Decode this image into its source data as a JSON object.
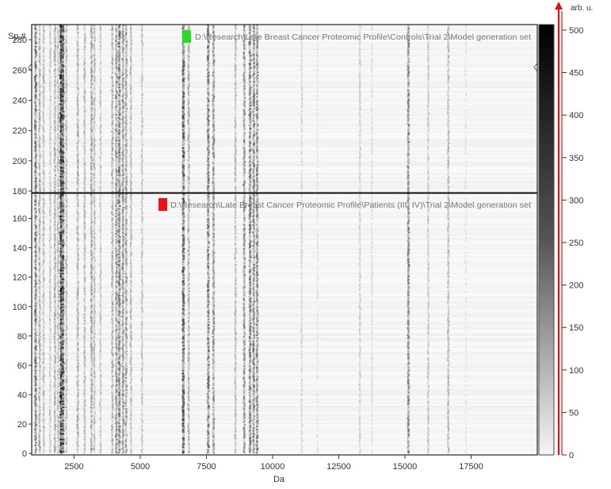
{
  "chart_data": {
    "type": "heatmap",
    "xlabel": "Da",
    "x_ticks": [
      "2500",
      "5000",
      "7500",
      "10000",
      "12500",
      "15000",
      "17500"
    ],
    "x_tick_values": [
      2500,
      5000,
      7500,
      10000,
      12500,
      15000,
      17500
    ],
    "xlim": [
      900,
      20000
    ],
    "colorbar": {
      "label": "arb. u.",
      "ticks": [
        "0",
        "50",
        "100",
        "150",
        "200",
        "250",
        "300",
        "350",
        "400",
        "450",
        "500"
      ],
      "tick_values": [
        0,
        50,
        100,
        150,
        200,
        250,
        300,
        350,
        400,
        450,
        500
      ],
      "range": [
        0,
        500
      ]
    },
    "panels": [
      {
        "title": "D:\\Research\\Late Breast Cancer Proteomic Profile\\Controls\\Trial 2\\Model generation set",
        "marker_color": "#22dd22",
        "ylabel": "Sp.#",
        "y_ticks": [
          "180",
          "200",
          "220",
          "240",
          "260",
          "280"
        ],
        "y_tick_values": [
          180,
          200,
          220,
          240,
          260,
          280
        ],
        "ylim": [
          179,
          290
        ],
        "spectra_range": [
          179,
          290
        ]
      },
      {
        "title": "D:\\Research\\Late Breast Cancer Proteomic Profile\\Patients (III, IV)\\Trial 2\\Model generation set",
        "marker_color": "#ee1111",
        "ylabel": "",
        "y_ticks": [
          "0",
          "20",
          "40",
          "60",
          "80",
          "100",
          "120",
          "140",
          "160"
        ],
        "y_tick_values": [
          0,
          20,
          40,
          60,
          80,
          100,
          120,
          140,
          160
        ],
        "ylim": [
          -1,
          177
        ],
        "spectra_range": [
          0,
          177
        ]
      }
    ],
    "peaks_da": [
      {
        "mass": 1050,
        "intensity": 0.55
      },
      {
        "mass": 1200,
        "intensity": 0.35
      },
      {
        "mass": 1350,
        "intensity": 0.3
      },
      {
        "mass": 1600,
        "intensity": 0.25
      },
      {
        "mass": 1780,
        "intensity": 0.35
      },
      {
        "mass": 1900,
        "intensity": 0.3
      },
      {
        "mass": 2020,
        "intensity": 0.9
      },
      {
        "mass": 2080,
        "intensity": 0.7
      },
      {
        "mass": 2210,
        "intensity": 0.3
      },
      {
        "mass": 2640,
        "intensity": 0.35
      },
      {
        "mass": 2900,
        "intensity": 0.3
      },
      {
        "mass": 3160,
        "intensity": 0.4
      },
      {
        "mass": 3270,
        "intensity": 0.3
      },
      {
        "mass": 3500,
        "intensity": 0.25
      },
      {
        "mass": 3950,
        "intensity": 0.35
      },
      {
        "mass": 4100,
        "intensity": 0.45
      },
      {
        "mass": 4210,
        "intensity": 0.55
      },
      {
        "mass": 4350,
        "intensity": 0.45
      },
      {
        "mass": 4470,
        "intensity": 0.4
      },
      {
        "mass": 4650,
        "intensity": 0.3
      },
      {
        "mass": 5070,
        "intensity": 0.25
      },
      {
        "mass": 6630,
        "intensity": 0.65
      },
      {
        "mass": 6830,
        "intensity": 0.35
      },
      {
        "mass": 7570,
        "intensity": 0.55
      },
      {
        "mass": 7770,
        "intensity": 0.45
      },
      {
        "mass": 8600,
        "intensity": 0.3
      },
      {
        "mass": 8930,
        "intensity": 0.45
      },
      {
        "mass": 9150,
        "intensity": 0.55
      },
      {
        "mass": 9290,
        "intensity": 0.5
      },
      {
        "mass": 9420,
        "intensity": 0.5
      },
      {
        "mass": 11100,
        "intensity": 0.18
      },
      {
        "mass": 11700,
        "intensity": 0.12
      },
      {
        "mass": 13300,
        "intensity": 0.22
      },
      {
        "mass": 13750,
        "intensity": 0.15
      },
      {
        "mass": 15130,
        "intensity": 0.5
      },
      {
        "mass": 15880,
        "intensity": 0.25
      },
      {
        "mass": 16640,
        "intensity": 0.3
      },
      {
        "mass": 17300,
        "intensity": 0.12
      }
    ]
  }
}
